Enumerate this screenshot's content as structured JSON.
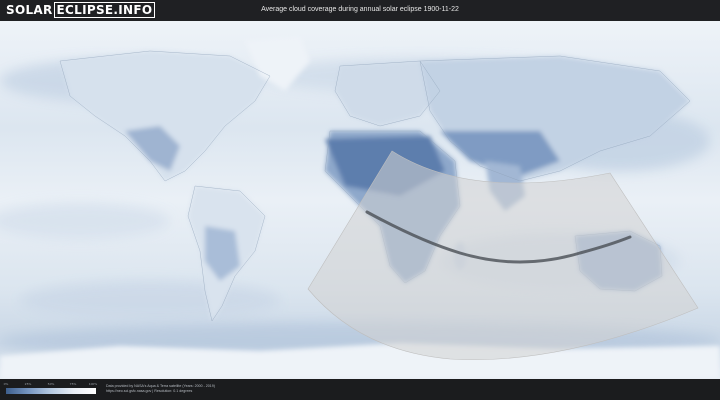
{
  "header": {
    "logo_part1": "SOLAR",
    "logo_part2": "ECLIPSE.INFO",
    "title": "Average cloud coverage during annual solar eclipse 1900-11-22"
  },
  "legend": {
    "ticks": [
      "0%",
      "25%",
      "50%",
      "75%",
      "100%"
    ],
    "colors": [
      "#3e5f8d",
      "#7796c1",
      "#b6cae2",
      "#e9eef5",
      "#ffffff"
    ]
  },
  "footer": {
    "credit_line1": "Data provided by NASA's Aqua & Terra satellite (Years: 2000 - 2019)",
    "credit_line2": "https://neo.sci.gsfc.nasa.gov | Resolution: 0.1 degrees"
  },
  "colors": {
    "ocean": "#dfe8f1",
    "land_clear": "#ecf1f7",
    "cloud_dense": "#5a7aa8",
    "eclipse_zone": "#d0d0d0",
    "central_line": "#4a4f55"
  }
}
